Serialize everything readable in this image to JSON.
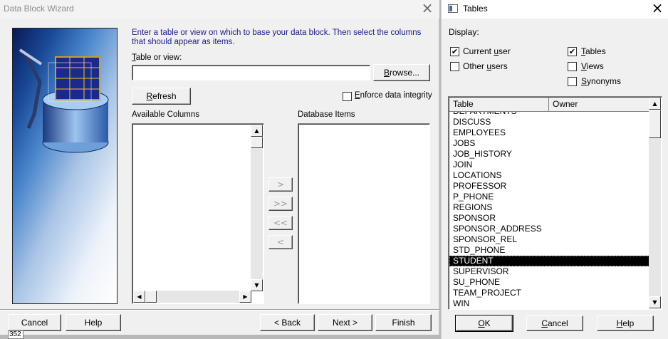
{
  "wizard": {
    "title": "Data Block Wizard",
    "instruction": "Enter a table or view on which to base your data block. Then select the columns that should appear as items.",
    "table_label_key": "T",
    "table_label_rest": "able or view:",
    "table_value": "",
    "browse_key": "B",
    "browse_rest": "rowse...",
    "refresh_key": "R",
    "refresh_rest": "efresh",
    "enforce_key": "E",
    "enforce_rest": "nforce data integrity",
    "enforce_checked": false,
    "available_columns_label": "Available Columns",
    "database_items_label": "Database Items",
    "move_buttons": [
      ">",
      ">>",
      "<<",
      "<"
    ],
    "footer": {
      "cancel": "Cancel",
      "help": "Help",
      "back": "< Back",
      "next": "Next >",
      "finish": "Finish"
    },
    "status_fragment": "352"
  },
  "tables_dialog": {
    "title": "Tables",
    "display_label": "Display:",
    "options": {
      "current_user": {
        "key": "u",
        "pre": "Current ",
        "rest": "ser",
        "checked": true
      },
      "other_users": {
        "key": "u",
        "pre": "Other ",
        "rest": "sers",
        "checked": false
      },
      "tables": {
        "key": "T",
        "pre": "",
        "rest": "ables",
        "checked": true
      },
      "views": {
        "key": "V",
        "pre": "",
        "rest": "iews",
        "checked": false
      },
      "synonyms": {
        "key": "S",
        "pre": "",
        "rest": "ynonyms",
        "checked": false
      }
    },
    "columns": [
      "Table",
      "Owner"
    ],
    "rows": [
      "DEPARTMENTS",
      "DISCUSS",
      "EMPLOYEES",
      "JOBS",
      "JOB_HISTORY",
      "JOIN",
      "LOCATIONS",
      "PROFESSOR",
      "P_PHONE",
      "REGIONS",
      "SPONSOR",
      "SPONSOR_ADDRESS",
      "SPONSOR_REL",
      "STD_PHONE",
      "STUDENT",
      "SUPERVISOR",
      "SU_PHONE",
      "TEAM_PROJECT",
      "WIN"
    ],
    "selected_row": "STUDENT",
    "buttons": {
      "ok_key": "O",
      "ok_rest": "K",
      "cancel_key": "C",
      "cancel_rest": "ancel",
      "help_key": "H",
      "help_rest": "elp"
    }
  },
  "colors": {
    "instruction_text": "#1a1a8c",
    "selected_row_bg": "#000000",
    "window_bg": "#f0f0f0"
  }
}
